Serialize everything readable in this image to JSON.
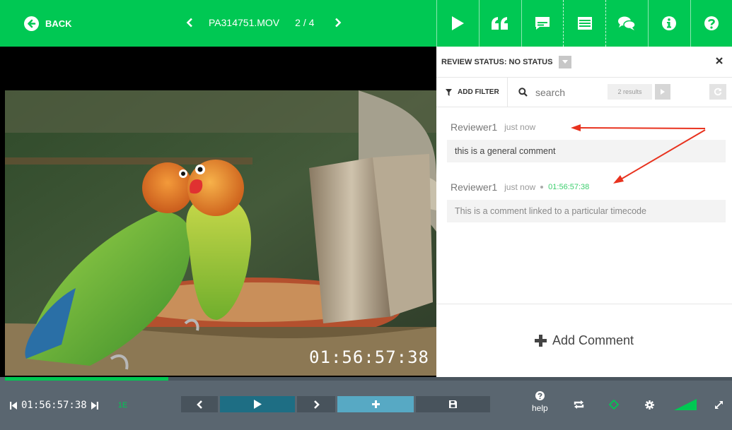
{
  "topbar": {
    "back_label": "BACK",
    "file_name": "PA314751.MOV",
    "file_position": "2 / 4",
    "tabs": [
      {
        "icon": "play-icon"
      },
      {
        "icon": "quote-icon"
      },
      {
        "icon": "subtitle-icon"
      },
      {
        "icon": "list-icon"
      },
      {
        "icon": "comments-icon"
      },
      {
        "icon": "info-icon"
      },
      {
        "icon": "help-icon"
      }
    ]
  },
  "video": {
    "timecode": "01:56:57:38"
  },
  "panel": {
    "review_status": "REVIEW STATUS: NO STATUS",
    "add_filter_label": "ADD FILTER",
    "search_placeholder": "search",
    "results_label": "2 results",
    "comments": [
      {
        "author": "Reviewer1",
        "time": "just now",
        "timecode": "",
        "text": "this is a general comment"
      },
      {
        "author": "Reviewer1",
        "time": "just now",
        "timecode": "01:56:57:38",
        "text": "This is a comment linked to a particular timecode"
      }
    ],
    "add_comment_label": "Add Comment"
  },
  "playback": {
    "current_timecode": "01:56:57:38",
    "frame_indicator": "1E",
    "progress_fraction": 0.225,
    "help_label": "help"
  },
  "colors": {
    "accent_green": "#00c853",
    "bottom_bar": "#5a6670",
    "play_button": "#1e6e84",
    "add_button": "#57a9c4",
    "annotation_arrow": "#e8321e"
  }
}
